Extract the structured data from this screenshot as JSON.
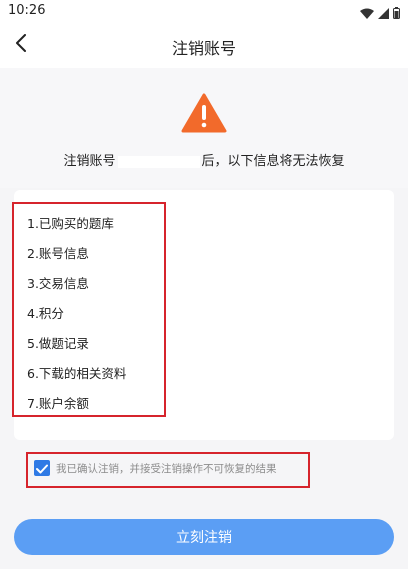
{
  "status_bar": {
    "time": "10:26",
    "icons": [
      "wifi-icon",
      "signal-icon",
      "battery-icon"
    ]
  },
  "header": {
    "title": "注销账号",
    "back_icon": "chevron-left-icon"
  },
  "warning": {
    "icon": "warning-triangle-icon",
    "icon_color": "#f26a2b",
    "text_before": "注销账号",
    "text_after": "后，以下信息将无法恢复"
  },
  "lost_items": [
    "1.已购买的题库",
    "2.账号信息",
    "3.交易信息",
    "4.积分",
    "5.做题记录",
    "6.下载的相关资料",
    "7.账户余额"
  ],
  "confirm": {
    "checked": true,
    "text": "我已确认注销，并接受注销操作不可恢复的结果"
  },
  "submit": {
    "label": "立刻注销",
    "color": "#5b9ef4"
  },
  "colors": {
    "highlight_border": "#d6242c",
    "checkbox": "#2f7ae5"
  }
}
